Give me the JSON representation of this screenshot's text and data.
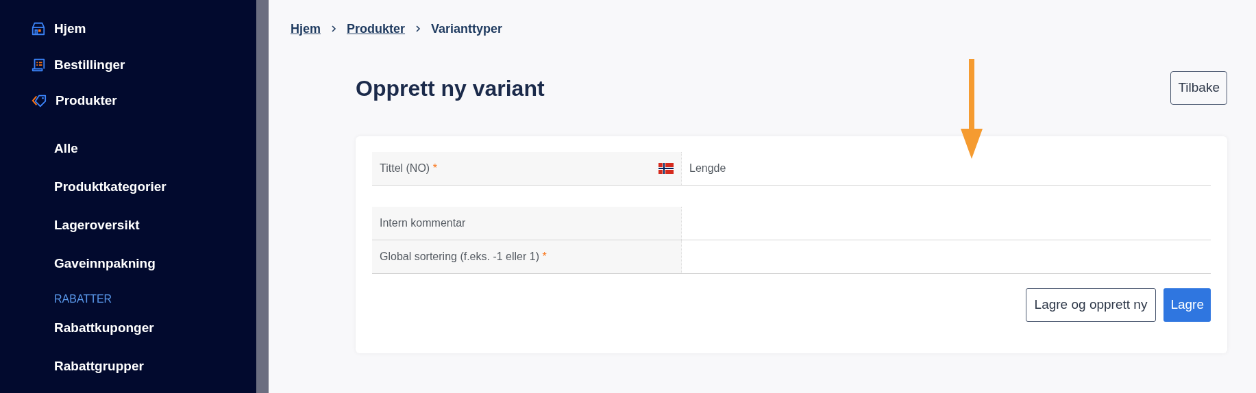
{
  "sidebar": {
    "items": [
      {
        "kind": "main",
        "label": "Hjem"
      },
      {
        "kind": "main",
        "label": "Bestillinger"
      },
      {
        "kind": "main",
        "label": "Produkter"
      },
      {
        "kind": "sub",
        "label": "Alle"
      },
      {
        "kind": "sub",
        "label": "Produktkategorier"
      },
      {
        "kind": "sub",
        "label": "Lageroversikt"
      },
      {
        "kind": "sub",
        "label": "Gaveinnpakning"
      },
      {
        "kind": "heading",
        "label": "RABATTER"
      },
      {
        "kind": "sub",
        "label": "Rabattkuponger"
      },
      {
        "kind": "sub",
        "label": "Rabattgrupper"
      }
    ]
  },
  "breadcrumb": [
    {
      "label": "Hjem",
      "link": true
    },
    {
      "label": "Produkter",
      "link": true
    },
    {
      "label": "Varianttyper",
      "link": false
    }
  ],
  "page_title": "Opprett ny variant",
  "back_button": "Tilbake",
  "form": {
    "rows": [
      {
        "kind": "translatable",
        "label": "Tittel (NO)",
        "required_mark": "*",
        "value": "Lengde"
      },
      {
        "kind": "plain",
        "label": "Intern kommentar"
      },
      {
        "kind": "plain",
        "label": "Global sortering (f.eks. -1 eller 1)",
        "required_mark": "*"
      }
    ],
    "buttons": [
      {
        "kind": "secondary",
        "label": "Lagre og opprett ny"
      },
      {
        "kind": "primary",
        "label": "Lagre"
      }
    ]
  }
}
